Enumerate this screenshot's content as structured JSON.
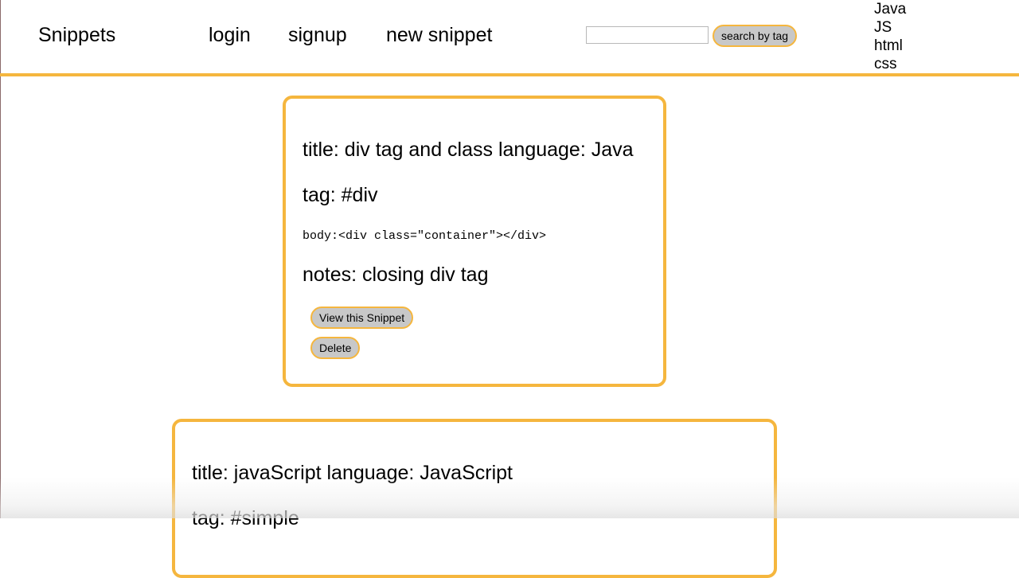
{
  "header": {
    "brand": "Snippets",
    "nav": {
      "login": "login",
      "signup": "signup",
      "new_snippet": "new snippet"
    },
    "search": {
      "value": "",
      "placeholder": "",
      "button_label": "search by tag"
    },
    "languages": [
      "Java",
      "JS",
      "html",
      "css"
    ]
  },
  "snippets": [
    {
      "title_line": "title: div tag and class language: Java",
      "tag_line": "tag: #div",
      "body_line": "body:<div class=\"container\"></div>",
      "notes_line": "notes: closing div tag",
      "view_label": "View this Snippet",
      "delete_label": "Delete"
    },
    {
      "title_line": "title: javaScript language: JavaScript",
      "tag_line": "tag: #simple"
    }
  ],
  "colors": {
    "accent": "#f5b63e",
    "button_bg": "#c8c8c8"
  }
}
